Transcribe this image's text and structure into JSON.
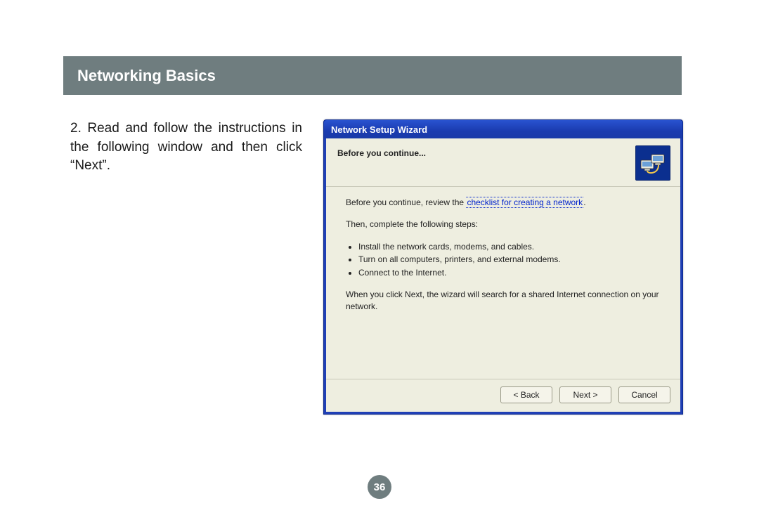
{
  "header": {
    "title": "Networking Basics"
  },
  "instruction": {
    "text": "2. Read and follow the instructions in the following window and then click “Next”."
  },
  "dialog": {
    "title": "Network Setup Wizard",
    "subtitle": "Before you continue...",
    "icon_name": "network-computers-icon",
    "review_prefix": "Before you continue, review the ",
    "review_link": "checklist for creating a network",
    "review_suffix": ".",
    "steps_intro": "Then, complete the following steps:",
    "steps": [
      "Install the network cards, modems, and cables.",
      "Turn on all computers, printers, and external modems.",
      "Connect to the Internet."
    ],
    "footer_note": "When you click Next, the wizard will search for a shared Internet connection on your network.",
    "buttons": {
      "back": "< Back",
      "next": "Next >",
      "cancel": "Cancel"
    }
  },
  "page_number": "36"
}
